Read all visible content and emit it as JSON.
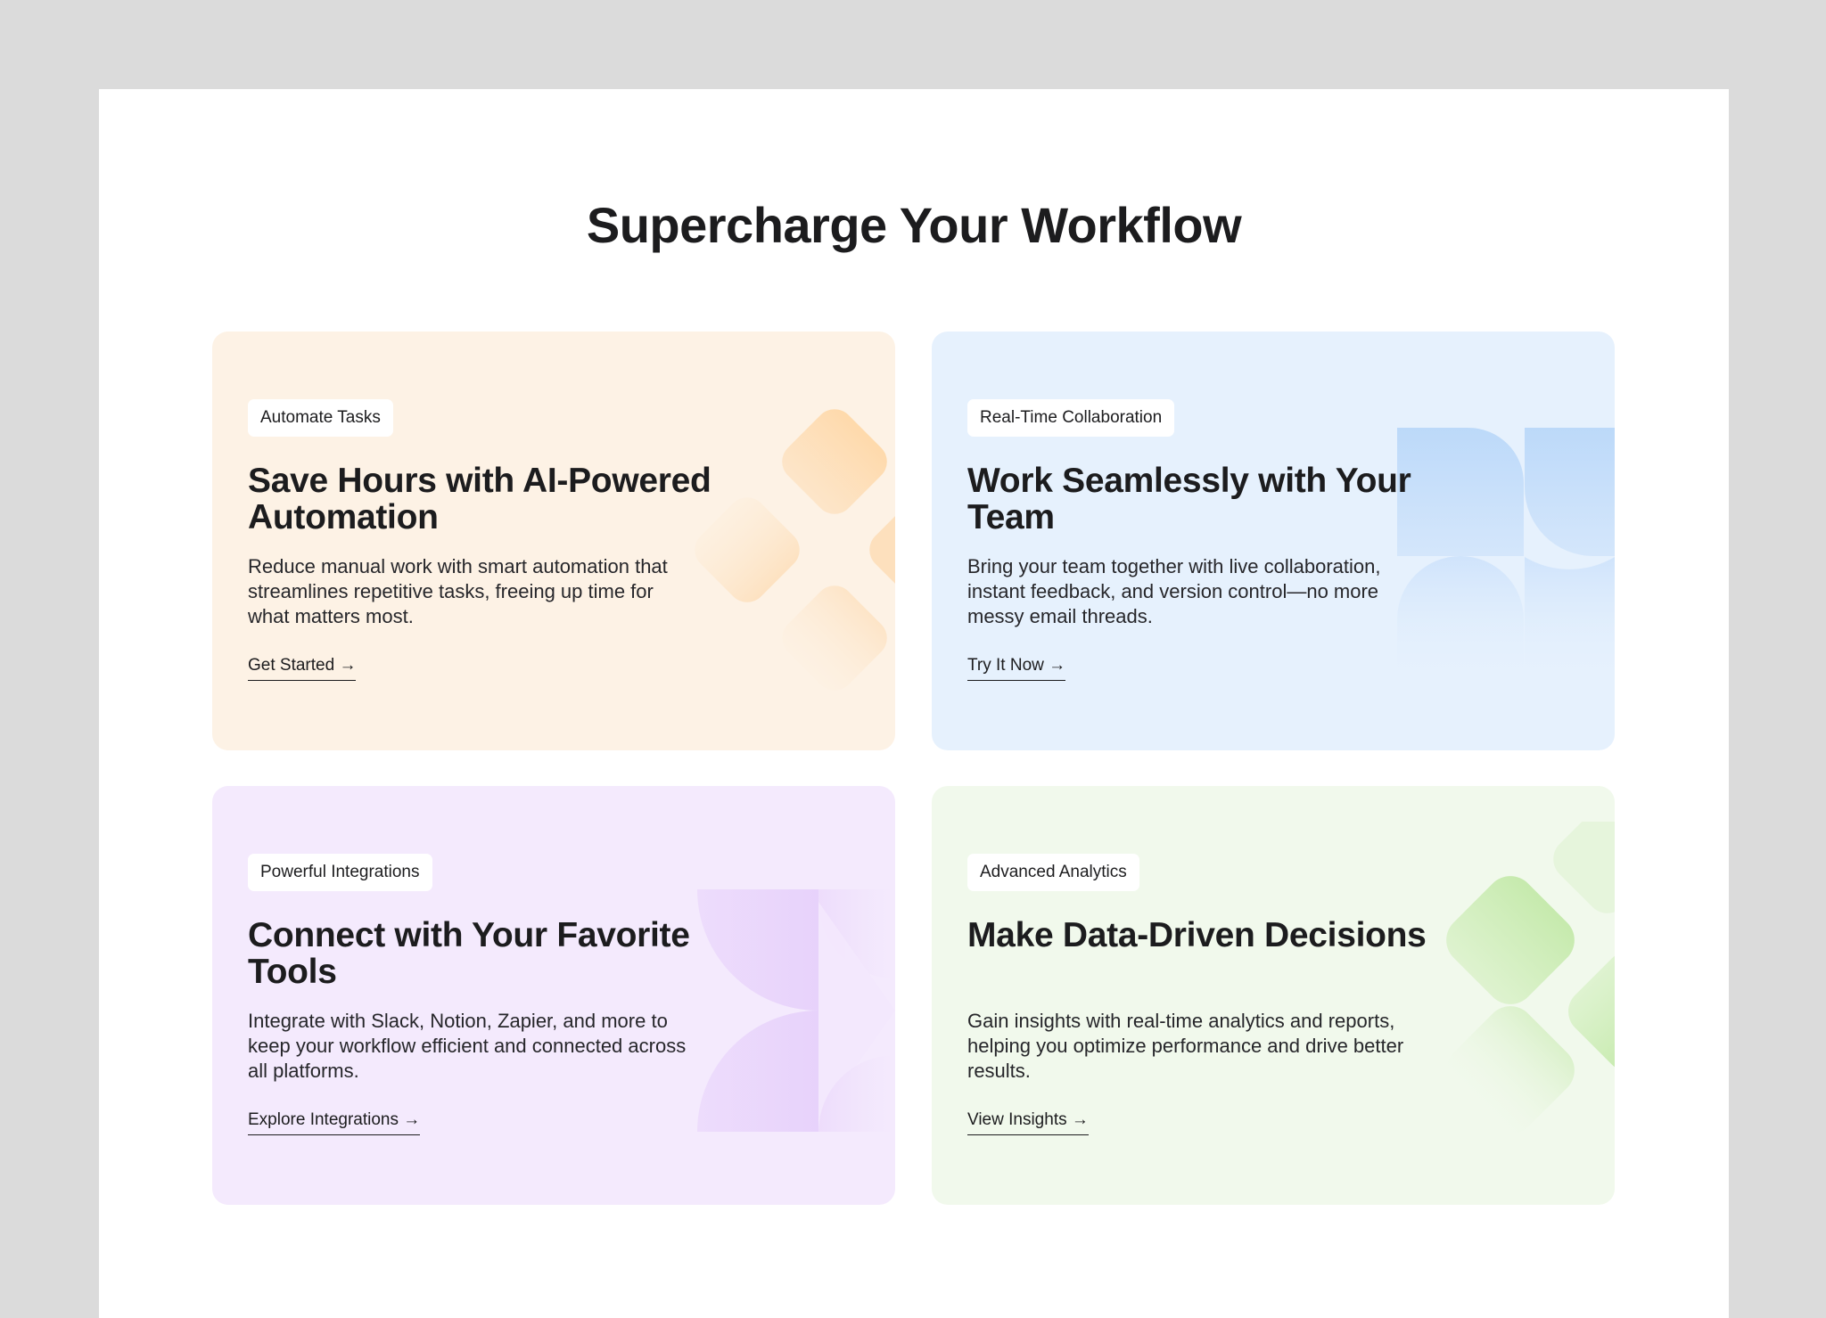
{
  "section": {
    "heading": "Supercharge Your Workflow"
  },
  "cards": [
    {
      "badge": "Automate Tasks",
      "title": "Save Hours with AI-Powered Automation",
      "description": "Reduce manual work with smart automation that streamlines repetitive tasks, freeing up time for what matters most.",
      "cta": "Get Started →",
      "accent": "#fdf2e5"
    },
    {
      "badge": "Real-Time Collaboration",
      "title": "Work Seamlessly with Your Team",
      "description": "Bring your team together with live collaboration, instant feedback, and version control—no more messy email threads.",
      "cta": "Try It Now →",
      "accent": "#e6f1fd"
    },
    {
      "badge": "Powerful Integrations",
      "title": "Connect with Your Favorite Tools",
      "description": "Integrate with Slack, Notion, Zapier, and more to keep your workflow efficient and connected across all platforms.",
      "cta": "Explore Integrations →",
      "accent": "#f4eafd"
    },
    {
      "badge": "Advanced Analytics",
      "title": "Make Data-Driven Decisions",
      "description": "Gain insights with real-time analytics and reports, helping you optimize performance and drive better results.",
      "cta": "View Insights →",
      "accent": "#f1f9ec"
    }
  ]
}
